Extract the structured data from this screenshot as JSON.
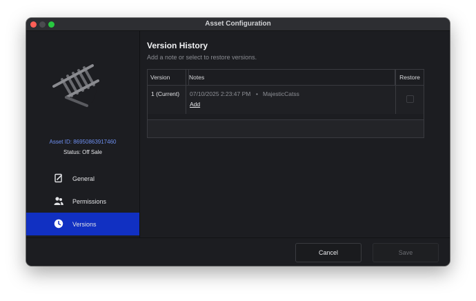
{
  "window": {
    "title": "Asset Configuration"
  },
  "sidebar": {
    "asset_id": "Asset ID: 86950863917460",
    "status": "Status: Off Sale",
    "items": [
      {
        "label": "General",
        "icon": "edit-document-icon",
        "selected": false
      },
      {
        "label": "Permissions",
        "icon": "users-icon",
        "selected": false
      },
      {
        "label": "Versions",
        "icon": "clock-icon",
        "selected": true
      }
    ],
    "selected_color": "#1130c2"
  },
  "main": {
    "title": "Version History",
    "subtitle": "Add a note or select to restore versions.",
    "table": {
      "headers": {
        "version": "Version",
        "notes": "Notes",
        "restore": "Restore"
      },
      "rows": [
        {
          "version": "1 (Current)",
          "date": "07/10/2025 2:23:47 PM",
          "separator": "•",
          "user": "MajesticCatss",
          "add_label": "Add",
          "restore_checked": false
        }
      ]
    }
  },
  "footer": {
    "cancel_label": "Cancel",
    "save_label": "Save"
  }
}
